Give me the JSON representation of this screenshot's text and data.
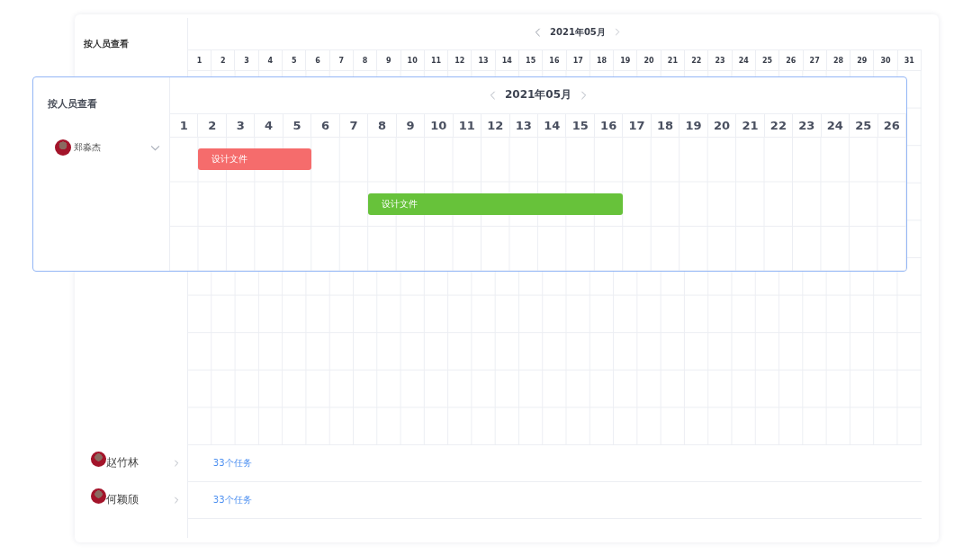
{
  "background_view": {
    "title": "按人员查看",
    "month": "2021年05月",
    "days": [
      "1",
      "2",
      "3",
      "4",
      "5",
      "6",
      "7",
      "8",
      "9",
      "10",
      "11",
      "12",
      "13",
      "14",
      "15",
      "16",
      "17",
      "18",
      "19",
      "20",
      "21",
      "22",
      "23",
      "24",
      "25",
      "26",
      "27",
      "28",
      "29",
      "30",
      "31"
    ],
    "people": [
      {
        "name": "赵竹林",
        "expanded": false,
        "tasks": "33个任务"
      },
      {
        "name": "何颖颀",
        "expanded": false,
        "tasks": "33个任务"
      }
    ]
  },
  "zoomed_view": {
    "title": "按人员查看",
    "month": "2021年05月",
    "days": [
      "1",
      "2",
      "3",
      "4",
      "5",
      "6",
      "7",
      "8",
      "9",
      "10",
      "11",
      "12",
      "13",
      "14",
      "15",
      "16",
      "17",
      "18",
      "19",
      "20",
      "21",
      "22",
      "23",
      "24",
      "25",
      "26"
    ],
    "person": {
      "name": "郑淼杰",
      "expanded": true
    },
    "tasks": [
      {
        "label": "设计文件",
        "color": "#f56c6c"
      },
      {
        "label": "设计文件",
        "color": "#67c23a"
      }
    ]
  }
}
